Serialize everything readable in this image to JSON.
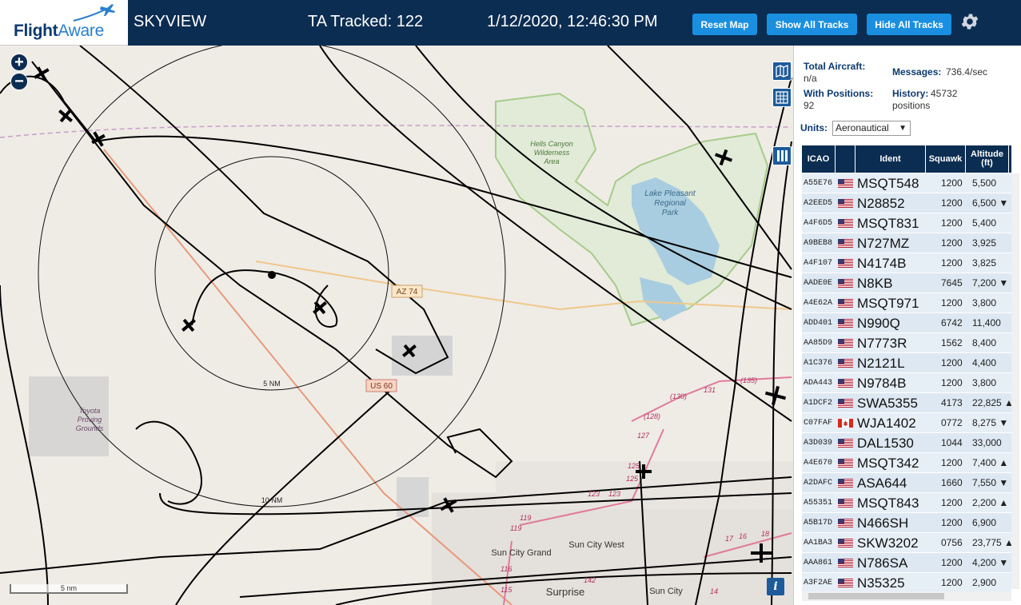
{
  "header": {
    "logo_text_1": "Flight",
    "logo_text_2": "Aware",
    "app_name": "SKYVIEW",
    "ta_tracked": "TA Tracked: 122",
    "datetime": "1/12/2020, 12:46:30 PM",
    "buttons": {
      "reset": "Reset Map",
      "show_all": "Show All Tracks",
      "hide_all": "Hide All Tracks"
    },
    "accent_color": "#1a8fe0",
    "bar_color": "#0c2d52"
  },
  "map": {
    "zoom_in": "+",
    "zoom_out": "−",
    "scale_label": "5 nm",
    "info_label": "i",
    "labels": {
      "hells_canyon": [
        "Hells Canyon",
        "Wilderness",
        "Area"
      ],
      "lake_pleasant": [
        "Lake Pleasant",
        "Regional",
        "Park"
      ],
      "toyota": [
        "Toyota",
        "Proving",
        "Grounds"
      ],
      "az74": "AZ 74",
      "us60": "US 60",
      "ring_5nm": "5 NM",
      "ring_10nm": "10 NM",
      "sun_city_grand": "Sun City Grand",
      "sun_city_west": "Sun City West",
      "sun_city": "Sun City",
      "surprise": "Surprise",
      "r130": "(130)",
      "r131": "131",
      "r135": "(135)",
      "r128": "(128)",
      "r127": "127",
      "r125a": "125",
      "r125b": "125",
      "r123a": "123",
      "r123b": "123",
      "r119a": "119",
      "r119b": "119",
      "r116": "116",
      "r115": "115",
      "r142": "142",
      "r14": "14",
      "r16": "16",
      "r17": "17",
      "r18": "18"
    }
  },
  "sidebar": {
    "total_aircraft_label": "Total Aircraft:",
    "total_aircraft_value": "n/a",
    "with_positions_label": "With Positions:",
    "with_positions_value": "92",
    "messages_label": "Messages:",
    "messages_value": "736.4/sec",
    "history_label": "History:",
    "history_value": "45732",
    "history_unit": "positions",
    "units_label": "Units:",
    "units_value": "Aeronautical",
    "columns": {
      "icao": "ICAO",
      "ident": "Ident",
      "squawk": "Squawk",
      "altitude": "Altitude",
      "altitude_unit": "(ft)"
    },
    "rows": [
      {
        "icao": "A55E76",
        "flag": "us",
        "ident": "MSQT548",
        "squawk": "1200",
        "alt": "5,500"
      },
      {
        "icao": "A2EED5",
        "flag": "us",
        "ident": "N28852",
        "squawk": "1200",
        "alt": "6,500 ▼"
      },
      {
        "icao": "A4F6D5",
        "flag": "us",
        "ident": "MSQT831",
        "squawk": "1200",
        "alt": "5,400"
      },
      {
        "icao": "A9BEB8",
        "flag": "us",
        "ident": "N727MZ",
        "squawk": "1200",
        "alt": "3,925"
      },
      {
        "icao": "A4F107",
        "flag": "us",
        "ident": "N4174B",
        "squawk": "1200",
        "alt": "3,825"
      },
      {
        "icao": "AADE0E",
        "flag": "us",
        "ident": "N8KB",
        "squawk": "7645",
        "alt": "7,200 ▼"
      },
      {
        "icao": "A4E62A",
        "flag": "us",
        "ident": "MSQT971",
        "squawk": "1200",
        "alt": "3,800"
      },
      {
        "icao": "ADD401",
        "flag": "us",
        "ident": "N990Q",
        "squawk": "6742",
        "alt": "11,400"
      },
      {
        "icao": "AA85D9",
        "flag": "us",
        "ident": "N7773R",
        "squawk": "1562",
        "alt": "8,400"
      },
      {
        "icao": "A1C376",
        "flag": "us",
        "ident": "N2121L",
        "squawk": "1200",
        "alt": "4,400"
      },
      {
        "icao": "ADA443",
        "flag": "us",
        "ident": "N9784B",
        "squawk": "1200",
        "alt": "3,800"
      },
      {
        "icao": "A1DCF2",
        "flag": "us",
        "ident": "SWA5355",
        "squawk": "4173",
        "alt": "22,825 ▲"
      },
      {
        "icao": "C07FAF",
        "flag": "ca",
        "ident": "WJA1402",
        "squawk": "0772",
        "alt": "8,275 ▼"
      },
      {
        "icao": "A3D039",
        "flag": "us",
        "ident": "DAL1530",
        "squawk": "1044",
        "alt": "33,000"
      },
      {
        "icao": "A4E670",
        "flag": "us",
        "ident": "MSQT342",
        "squawk": "1200",
        "alt": "7,400 ▲"
      },
      {
        "icao": "A2DAFC",
        "flag": "us",
        "ident": "ASA644",
        "squawk": "1660",
        "alt": "7,550 ▼"
      },
      {
        "icao": "A55351",
        "flag": "us",
        "ident": "MSQT843",
        "squawk": "1200",
        "alt": "2,200 ▲"
      },
      {
        "icao": "A5B17D",
        "flag": "us",
        "ident": "N466SH",
        "squawk": "1200",
        "alt": "6,900"
      },
      {
        "icao": "AA1BA3",
        "flag": "us",
        "ident": "SKW3202",
        "squawk": "0756",
        "alt": "23,775 ▲"
      },
      {
        "icao": "AAA861",
        "flag": "us",
        "ident": "N786SA",
        "squawk": "1200",
        "alt": "4,200 ▼"
      },
      {
        "icao": "A3F2AE",
        "flag": "us",
        "ident": "N35325",
        "squawk": "1200",
        "alt": "2,900"
      }
    ]
  }
}
